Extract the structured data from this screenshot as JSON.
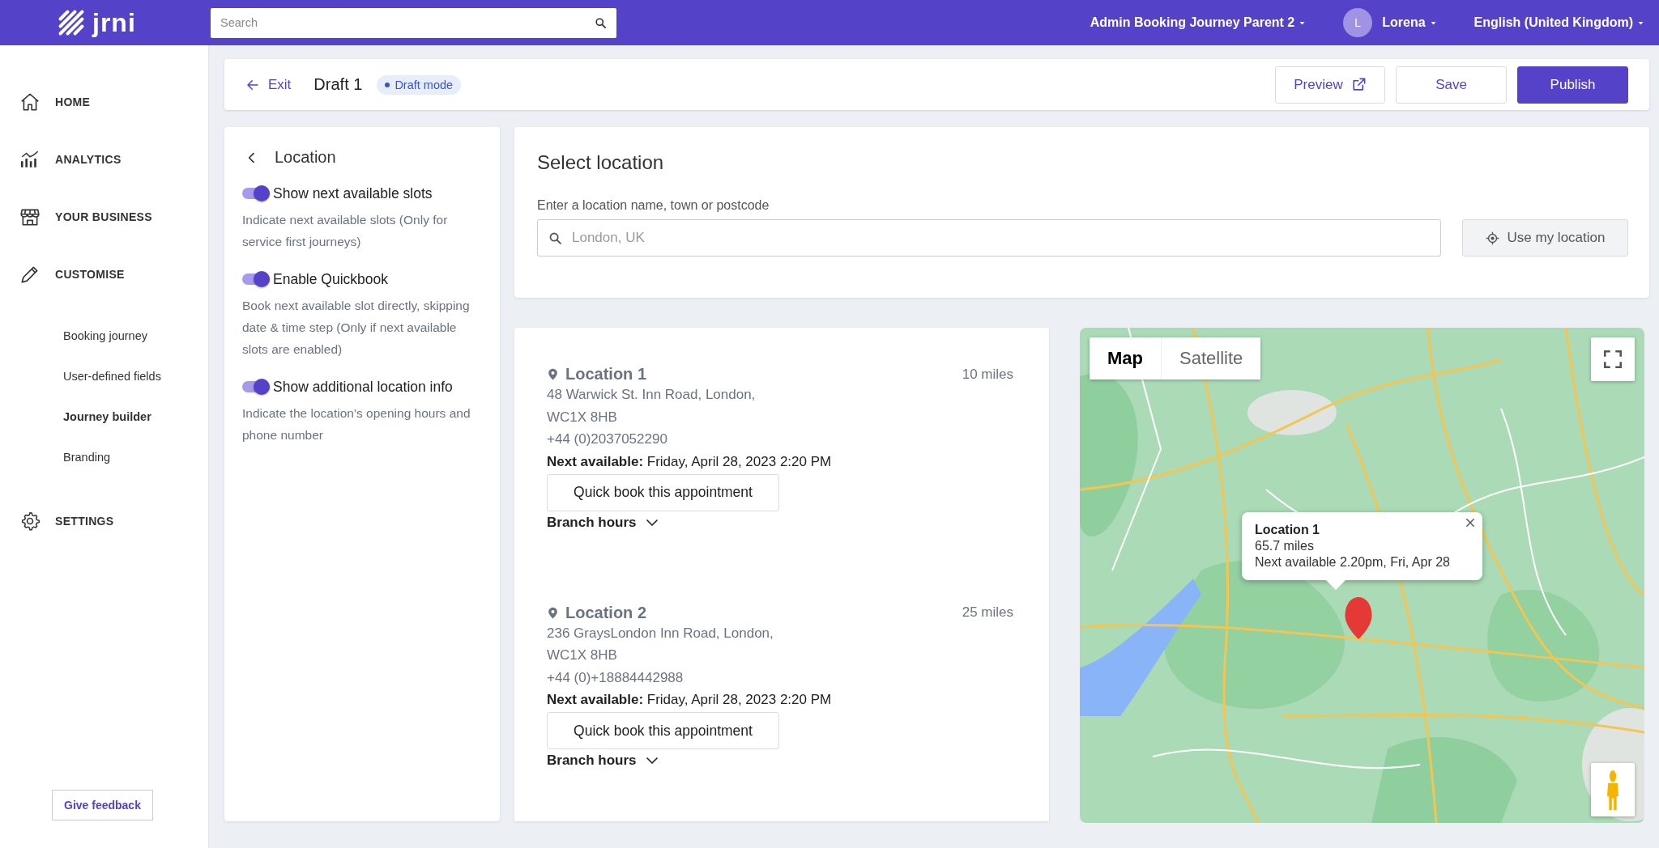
{
  "topbar": {
    "logo": "jrni",
    "search_placeholder": "Search",
    "account": "Admin Booking Journey Parent 2",
    "user": {
      "initial": "L",
      "name": "Lorena"
    },
    "language": "English (United Kingdom)"
  },
  "sidebar": {
    "items": [
      {
        "label": "HOME",
        "selected": false
      },
      {
        "label": "ANALYTICS",
        "selected": false
      },
      {
        "label": "YOUR BUSINESS",
        "selected": false
      },
      {
        "label": "CUSTOMISE",
        "selected": false,
        "children": [
          {
            "label": "Booking journey",
            "selected": false
          },
          {
            "label": "User-defined fields",
            "selected": false
          },
          {
            "label": "Journey builder",
            "selected": true
          },
          {
            "label": "Branding",
            "selected": false
          }
        ]
      },
      {
        "label": "SETTINGS",
        "selected": false
      }
    ],
    "feedback": "Give feedback"
  },
  "header": {
    "back": "Exit",
    "title": "Draft 1",
    "badge": "Draft mode",
    "buttons": [
      {
        "label": "Preview",
        "kind": "external"
      },
      {
        "label": "Save",
        "kind": "secondary"
      },
      {
        "label": "Publish",
        "kind": "primary"
      }
    ]
  },
  "panel": {
    "title": "Location",
    "settings": [
      {
        "label": "Show next available slots",
        "description": "Indicate next available slots (Only for service first journeys)",
        "on": true
      },
      {
        "label": "Enable Quickbook",
        "description": "Book next available slot directly, skipping date & time step (Only if next available slots are enabled)",
        "on": true
      },
      {
        "label": "Show additional location info",
        "description": "Indicate the location’s opening hours and phone number",
        "on": true
      }
    ]
  },
  "location_search": {
    "title": "Select location",
    "label": "Enter a location name, town or postcode",
    "placeholder": "London, UK",
    "button": "Use my location"
  },
  "locations": [
    {
      "name": "Location 1",
      "distance": "10 miles",
      "address_lines": [
        "48 Warwick St. Inn Road, London,",
        "WC1X 8HB"
      ],
      "phone": "+44 (0)2037052290",
      "next_available": "**Next available:** Friday, April 28, 2023 2:20 PM",
      "button": "Quick book this appointment",
      "hours": "Branch hours"
    },
    {
      "name": "Location 2",
      "distance": "25 miles",
      "address_lines": [
        "236 GraysLondon Inn Road, London,",
        "WC1X 8HB"
      ],
      "phone": "+44 (0)+18884442988",
      "next_available": "**Next available:** Friday, April 28, 2023 2:20 PM",
      "button": "Quick book this appointment",
      "hours": "Branch hours"
    }
  ],
  "map": {
    "tabs": [
      {
        "label": "Map",
        "selected": true
      },
      {
        "label": "Satellite",
        "selected": false
      }
    ],
    "popup": {
      "title": "Location 1",
      "distance": "65.7 miles",
      "next": "Next available 2.20pm, Fri, Apr 28"
    }
  }
}
